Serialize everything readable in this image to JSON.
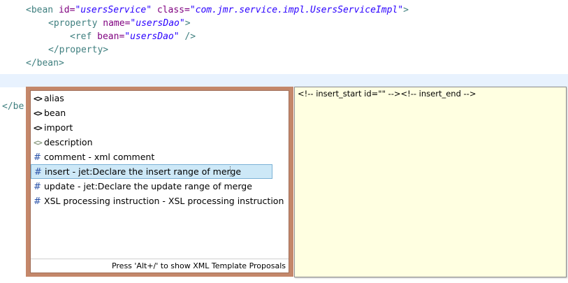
{
  "editor": {
    "lines": {
      "l1": {
        "open": "<bean ",
        "attr1": "id=",
        "val1": "\"usersService\"",
        "attr2": " class=",
        "val2": "\"com.jmr.service.impl.UsersServiceImpl\"",
        "close": ">"
      },
      "l2": {
        "open": "<property ",
        "attr1": "name=",
        "val1": "\"usersDao\"",
        "close": ">"
      },
      "l3": {
        "open": "<ref ",
        "attr1": "bean=",
        "val1": "\"usersDao\"",
        "close": " />"
      },
      "l4": {
        "text": "</property>"
      },
      "l5": {
        "text": "</bean>"
      },
      "l6": {
        "text": "</be"
      }
    }
  },
  "popup": {
    "proposals": [
      {
        "icon": "<>",
        "icon_name": "element-icon",
        "label": "alias"
      },
      {
        "icon": "<>",
        "icon_name": "element-icon",
        "label": "bean"
      },
      {
        "icon": "<>",
        "icon_name": "element-icon",
        "label": "import"
      },
      {
        "icon": "<>",
        "icon_name": "element-faded-icon",
        "label": "description"
      },
      {
        "icon": "#",
        "icon_name": "template-icon",
        "label": "comment - xml comment"
      },
      {
        "icon": "#",
        "icon_name": "template-icon",
        "label": "insert - jet:Declare the insert range of merge"
      },
      {
        "icon": "#",
        "icon_name": "template-icon",
        "label": "update - jet:Declare the update range of merge"
      },
      {
        "icon": "#",
        "icon_name": "template-icon",
        "label": "XSL processing instruction - XSL processing instruction"
      }
    ],
    "selected_index": 5,
    "footer": "Press 'Alt+/' to show XML Template Proposals"
  },
  "info": {
    "preview": "<!-- insert_start id=\"\" --><!-- insert_end -->"
  },
  "colors": {
    "popup_frame": "#c4876a",
    "info_bg": "#ffffe1",
    "selection_bg": "#cde8f7",
    "current_line": "#e8f2fe"
  }
}
